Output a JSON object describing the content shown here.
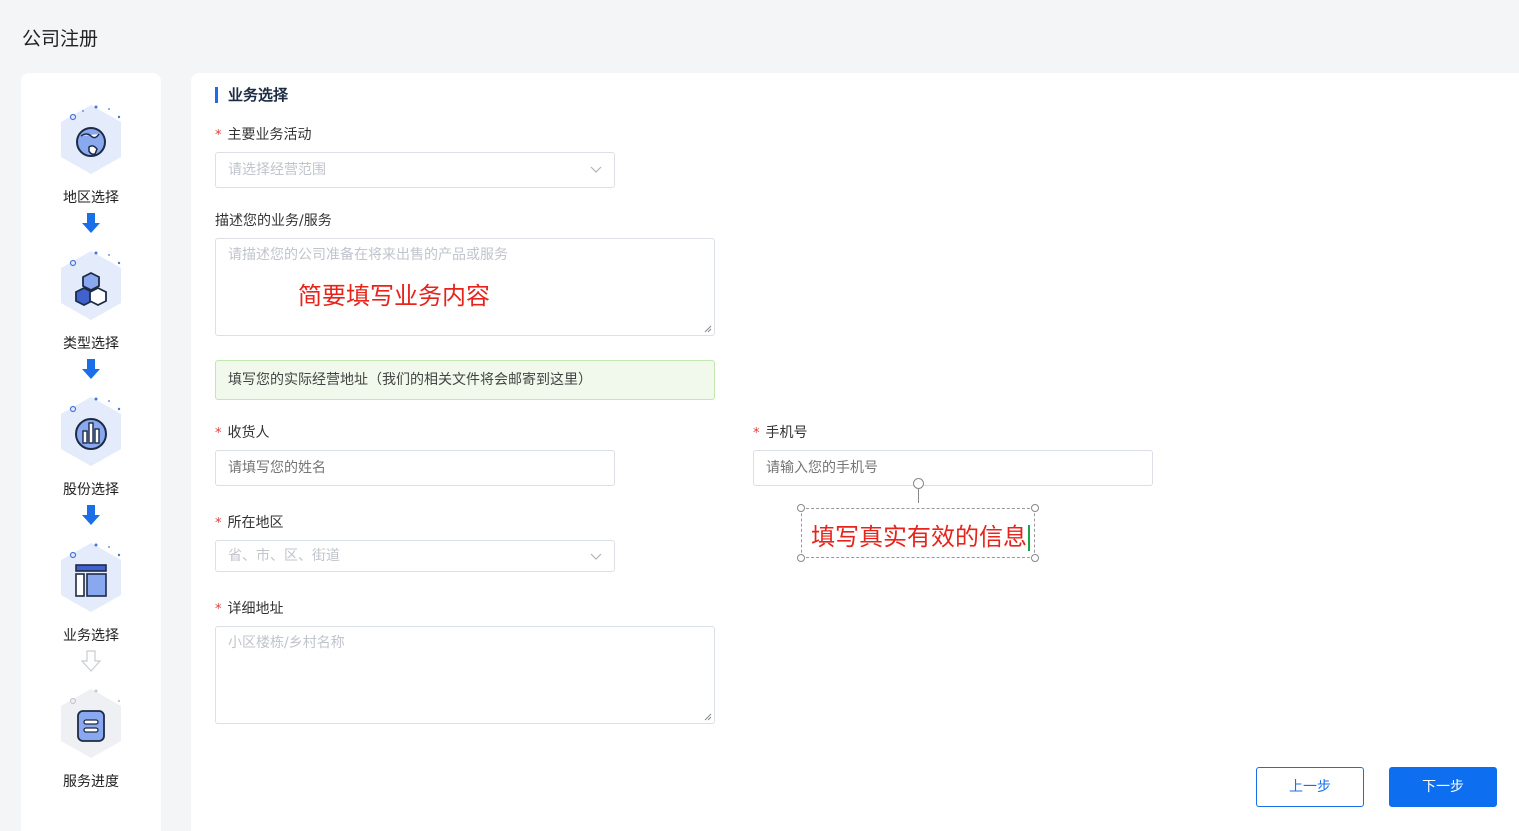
{
  "page": {
    "title": "公司注册"
  },
  "steps": [
    {
      "label": "地区选择",
      "icon": "globe-icon",
      "done": true
    },
    {
      "label": "类型选择",
      "icon": "hexagons-icon",
      "done": true
    },
    {
      "label": "股份选择",
      "icon": "bar-chart-icon",
      "done": true
    },
    {
      "label": "业务选择",
      "icon": "layout-icon",
      "done": true
    },
    {
      "label": "服务进度",
      "icon": "document-icon",
      "done": false
    }
  ],
  "form": {
    "section_title": "业务选择",
    "required_mark": "*",
    "business_activity": {
      "label": "主要业务活动",
      "placeholder": "请选择经营范围"
    },
    "description": {
      "label": "描述您的业务/服务",
      "placeholder": "请描述您的公司准备在将来出售的产品或服务"
    },
    "address_tip": "填写您的实际经营地址（我们的相关文件将会邮寄到这里）",
    "recipient": {
      "label": "收货人",
      "placeholder": "请填写您的姓名"
    },
    "phone": {
      "label": "手机号",
      "placeholder": "请输入您的手机号"
    },
    "region": {
      "label": "所在地区",
      "placeholder": "省、市、区、街道"
    },
    "detail_address": {
      "label": "详细地址",
      "placeholder": "小区楼栋/乡村名称"
    }
  },
  "annotations": {
    "description_hint": "简要填写业务内容",
    "info_hint": "填写真实有效的信息"
  },
  "buttons": {
    "prev": "上一步",
    "next": "下一步"
  },
  "colors": {
    "primary": "#0d6ef0",
    "annotation": "#e8231b",
    "tip_bg": "#f0f9eb"
  }
}
